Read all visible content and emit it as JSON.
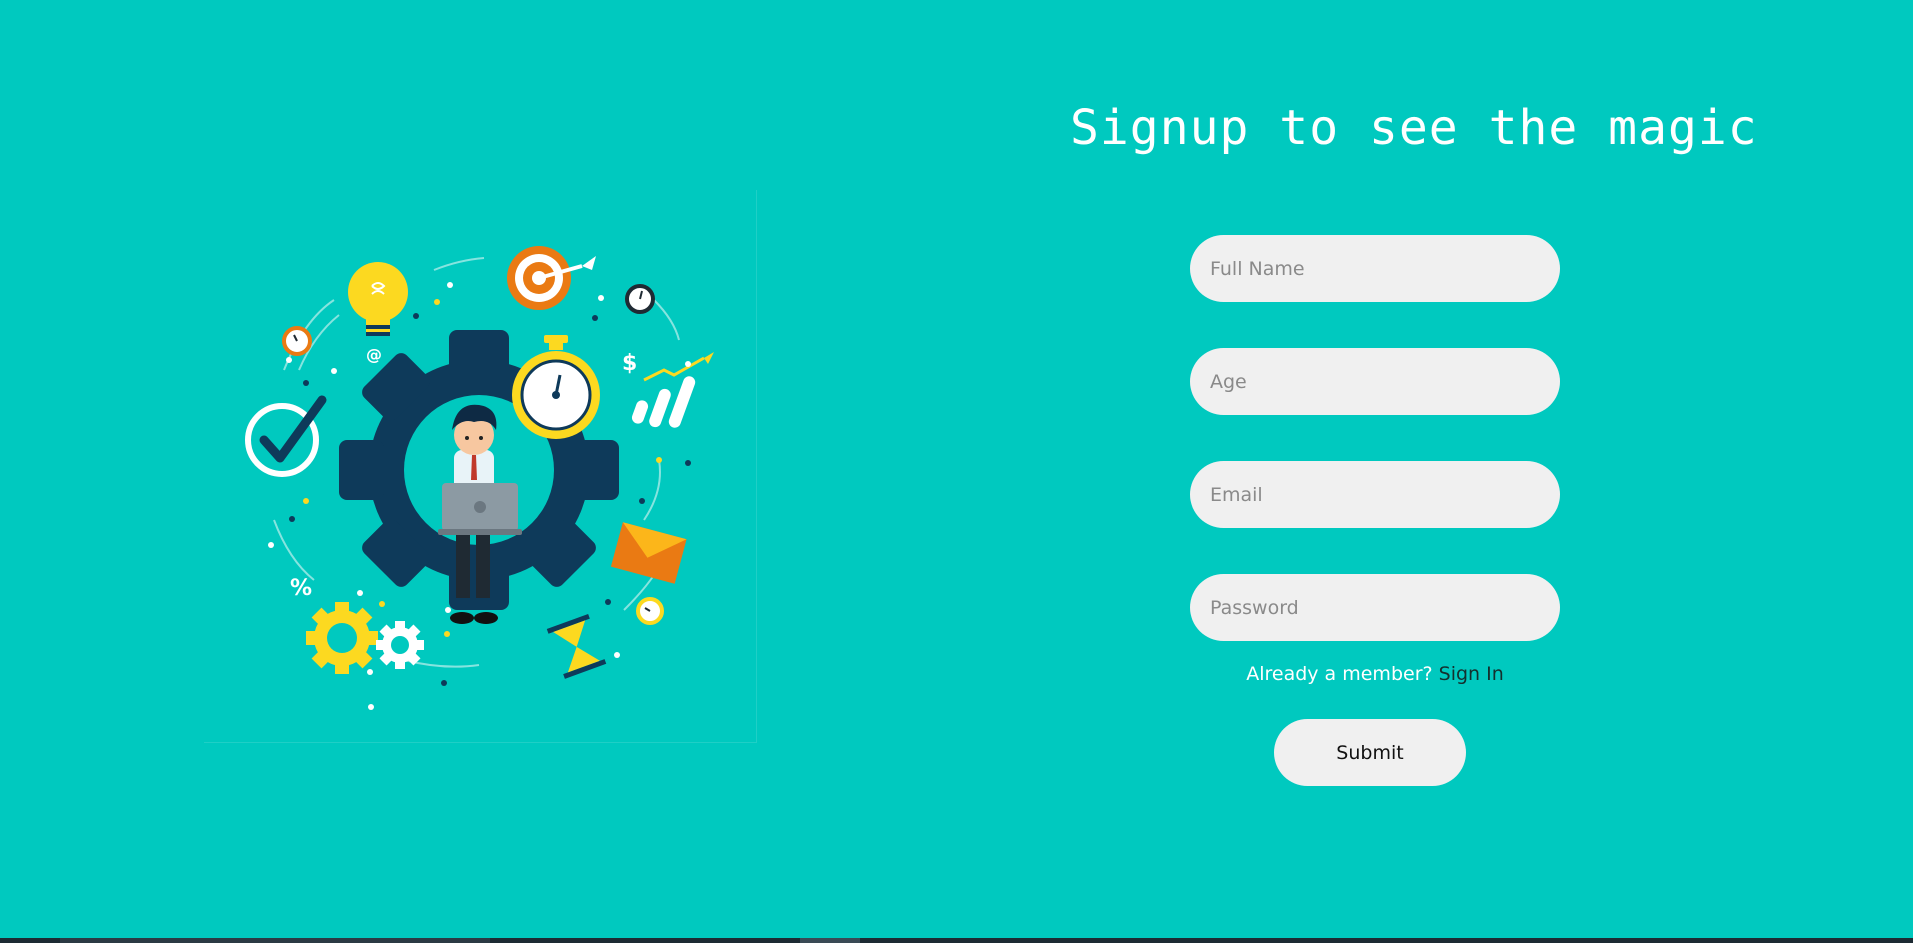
{
  "header": {
    "title": "Signup to see the magic"
  },
  "form": {
    "full_name_placeholder": "Full Name",
    "age_placeholder": "Age",
    "email_placeholder": "Email",
    "password_placeholder": "Password",
    "member_prompt": "Already a member?",
    "sign_in_label": "Sign In",
    "submit_label": "Submit"
  },
  "illustration": {
    "icons": [
      "gear-icon",
      "lightbulb-icon",
      "target-icon",
      "stopwatch-icon",
      "checkmark-icon",
      "chart-icon",
      "envelope-icon",
      "hourglass-icon",
      "clock-icon",
      "dollar-icon",
      "percent-icon",
      "at-icon",
      "person-with-laptop"
    ],
    "labels": {
      "at": "@",
      "dollar": "$",
      "percent": "%"
    }
  },
  "colors": {
    "background": "#00c9bf",
    "input_background": "#f0f0f0",
    "gear": "#0e3a5a",
    "accent_yellow": "#fcd920",
    "accent_orange": "#ea7a13",
    "link": "#14302e"
  }
}
